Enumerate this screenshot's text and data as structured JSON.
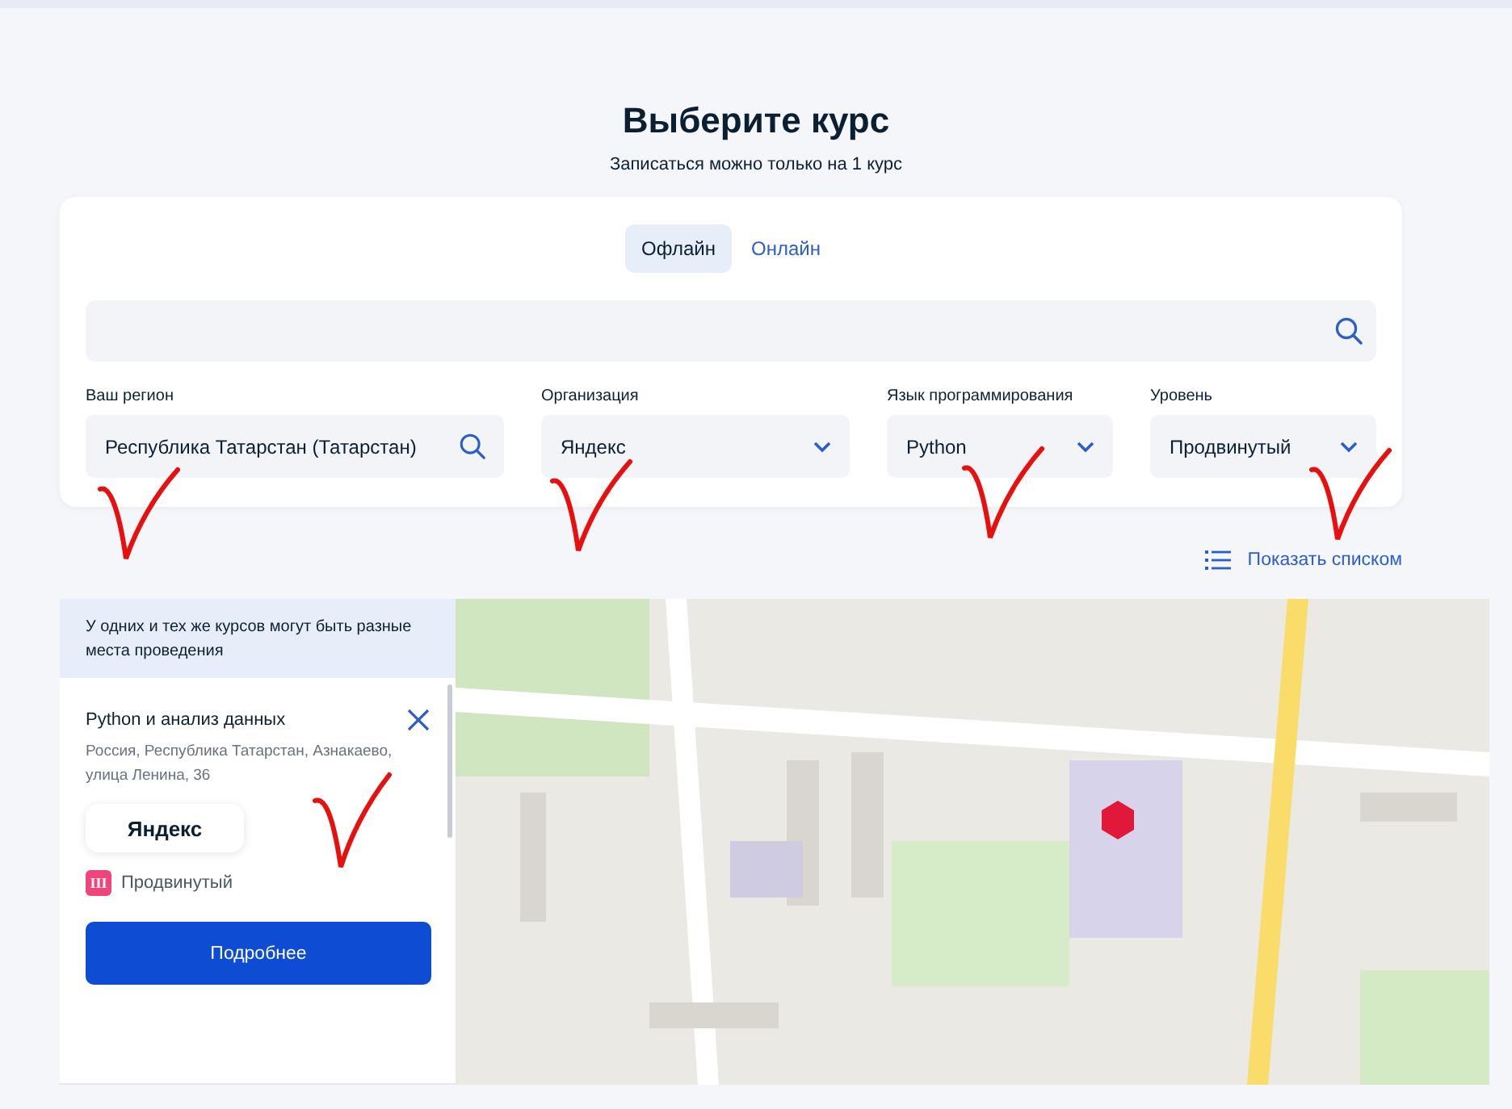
{
  "header": {
    "title": "Выберите курс",
    "subtitle": "Записаться можно только на 1 курс"
  },
  "tabs": [
    {
      "label": "Офлайн",
      "selected": true
    },
    {
      "label": "Онлайн",
      "selected": false
    }
  ],
  "filters": [
    {
      "label": "Ваш регион",
      "value": "Республика Татарстан (Татарстан)",
      "kind": "search",
      "marked": true
    },
    {
      "label": "Организация",
      "value": "Яндекс",
      "kind": "select",
      "marked": true
    },
    {
      "label": "Язык программирования",
      "value": "Python",
      "kind": "select",
      "marked": true
    },
    {
      "label": "Уровень",
      "value": "Продвинутый",
      "kind": "select",
      "marked": true
    }
  ],
  "list_link": "Показать списком",
  "notice": "У одних и тех же курсов могут быть разные места проведения",
  "course": {
    "title": "Python и анализ данных",
    "address": "Россия, Республика Татарстан, Азнакаево, улица Ленина, 36",
    "organization_logo": "Яндекс",
    "level_badge": "III",
    "level": "Продвинутый",
    "button": "Подробнее",
    "marked": true
  }
}
